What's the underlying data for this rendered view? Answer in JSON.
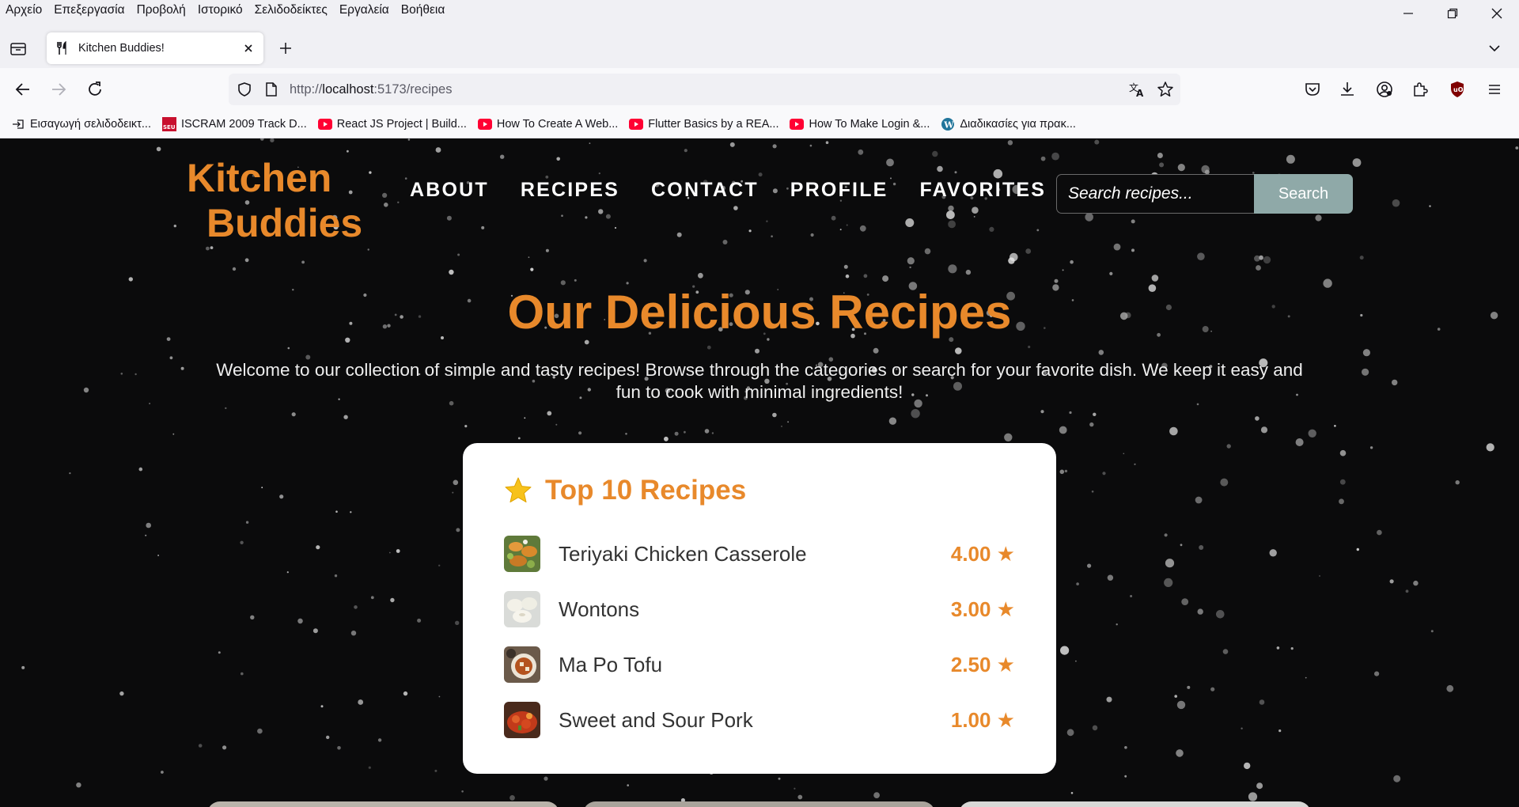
{
  "menubar": {
    "items": [
      "Αρχείο",
      "Επεξεργασία",
      "Προβολή",
      "Ιστορικό",
      "Σελιδοδείκτες",
      "Εργαλεία",
      "Βοήθεια"
    ]
  },
  "tab": {
    "title": "Kitchen Buddies!"
  },
  "urlbar": {
    "prefix": "http://",
    "host": "localhost",
    "rest": ":5173/recipes"
  },
  "bookmarks": [
    {
      "label": "Εισαγωγή σελιδοδεικτ...",
      "icon": "import-icon"
    },
    {
      "label": "ISCRAM 2009 Track D...",
      "icon": "seu-favicon"
    },
    {
      "label": "React JS Project | Build...",
      "icon": "youtube-icon"
    },
    {
      "label": "How To Create A Web...",
      "icon": "youtube-icon"
    },
    {
      "label": "Flutter Basics by a REA...",
      "icon": "youtube-icon"
    },
    {
      "label": "How To Make Login &...",
      "icon": "youtube-icon"
    },
    {
      "label": "Διαδικασίες για πρακ...",
      "icon": "wordpress-icon"
    }
  ],
  "site": {
    "logo_line1": "Kitchen",
    "logo_line2": "Buddies",
    "nav": [
      "ABOUT",
      "RECIPES",
      "CONTACT",
      "PROFILE",
      "FAVORITES"
    ],
    "search_placeholder": "Search recipes...",
    "search_button": "Search",
    "hero_title": "Our Delicious Recipes",
    "hero_subtitle": "Welcome to our collection of simple and tasty recipes! Browse through the categories or search for your favorite dish. We keep it easy and fun to cook with minimal ingredients!",
    "top_title": "Top 10 Recipes",
    "top_recipes": [
      {
        "name": "Teriyaki Chicken Casserole",
        "rating": "4.00 ★"
      },
      {
        "name": "Wontons",
        "rating": "3.00 ★"
      },
      {
        "name": "Ma Po Tofu",
        "rating": "2.50 ★"
      },
      {
        "name": "Sweet and Sour Pork",
        "rating": "1.00 ★"
      }
    ]
  },
  "colors": {
    "accent": "#e8892b",
    "search_button": "#8fa9a8",
    "page_bg": "#0b0b0c"
  }
}
